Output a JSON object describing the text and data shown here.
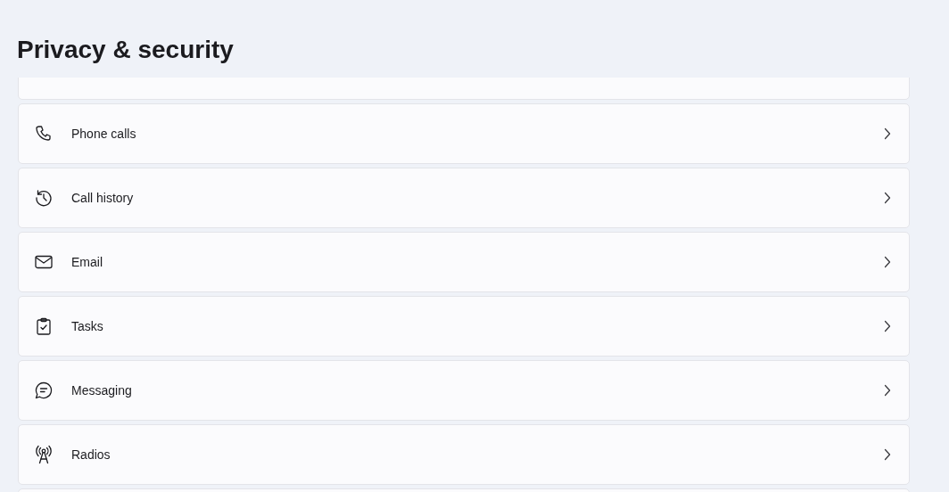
{
  "title": "Privacy & security",
  "items": [
    {
      "kind": "cut"
    },
    {
      "kind": "phone",
      "label": "Phone calls"
    },
    {
      "kind": "history",
      "label": "Call history"
    },
    {
      "kind": "email",
      "label": "Email"
    },
    {
      "kind": "tasks",
      "label": "Tasks"
    },
    {
      "kind": "messaging",
      "label": "Messaging"
    },
    {
      "kind": "radios",
      "label": "Radios"
    },
    {
      "kind": "cut"
    }
  ]
}
